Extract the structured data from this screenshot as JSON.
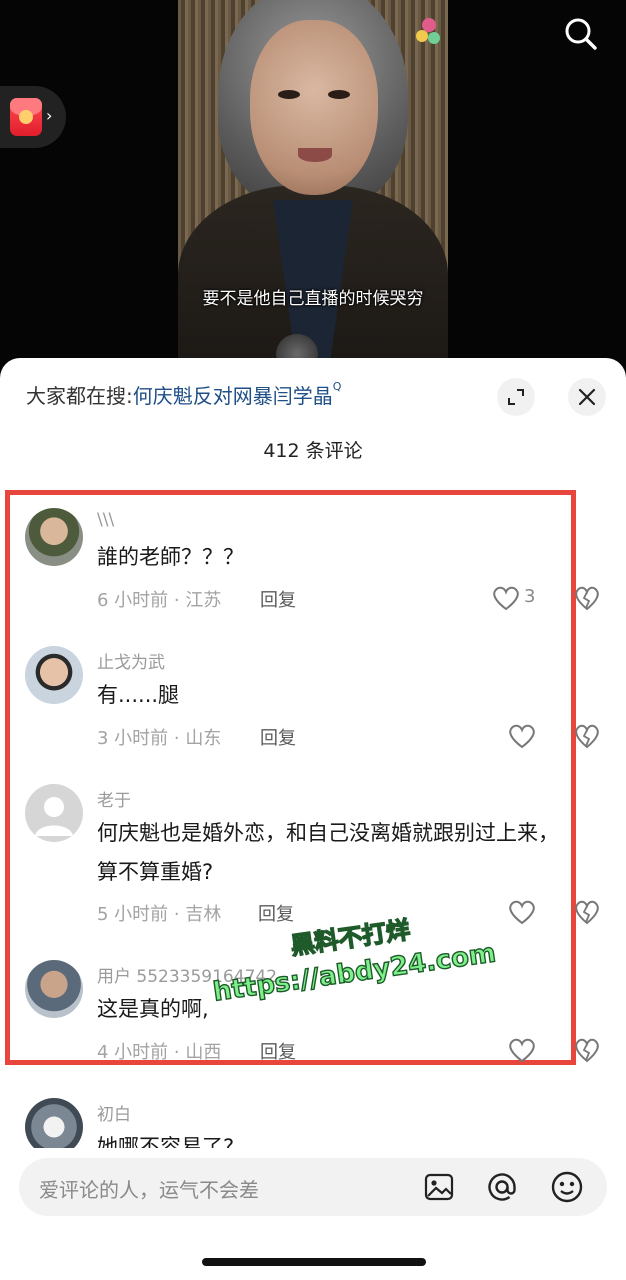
{
  "video": {
    "subtitle": "要不是他自己直播的时候哭穷"
  },
  "sheet": {
    "hot_search_prefix": "大家都在搜:",
    "hot_search_link": "何庆魁反对网暴闫学晶",
    "comment_count": "412 条评论"
  },
  "comments": [
    {
      "name": "\\\\\\",
      "text": "誰的老師？？？",
      "time_location": "6 小时前 · 江苏",
      "reply": "回复",
      "likes": "3"
    },
    {
      "name": "止戈为武",
      "text": "有......腿",
      "time_location": "3 小时前 · 山东",
      "reply": "回复",
      "likes": ""
    },
    {
      "name": "老于",
      "text": "何庆魁也是婚外恋，和自己没离婚就跟别过上来，算不算重婚?",
      "time_location": "5 小时前 · 吉林",
      "reply": "回复",
      "likes": ""
    },
    {
      "name": "用户 5523359164742",
      "text": "这是真的啊,",
      "time_location": "4 小时前 · 山西",
      "reply": "回复",
      "likes": ""
    },
    {
      "name": "初白",
      "text": "她哪不容易了?",
      "time_location": "",
      "reply": "",
      "likes": ""
    }
  ],
  "watermark": {
    "line1": "黑料不打烊",
    "line2": "https://abdy24.com"
  },
  "input": {
    "placeholder": "爱评论的人，运气不会差"
  },
  "icons": {
    "top_right": "search-icon",
    "float_left": "red-packet-icon",
    "sheet_actions": [
      "expand-icon",
      "close-icon"
    ],
    "input_actions": [
      "image-icon",
      "at-icon",
      "emoji-icon"
    ]
  },
  "colors": {
    "highlight_border": "#e8453c",
    "link": "#1f4f86",
    "watermark": "#7df08a"
  }
}
